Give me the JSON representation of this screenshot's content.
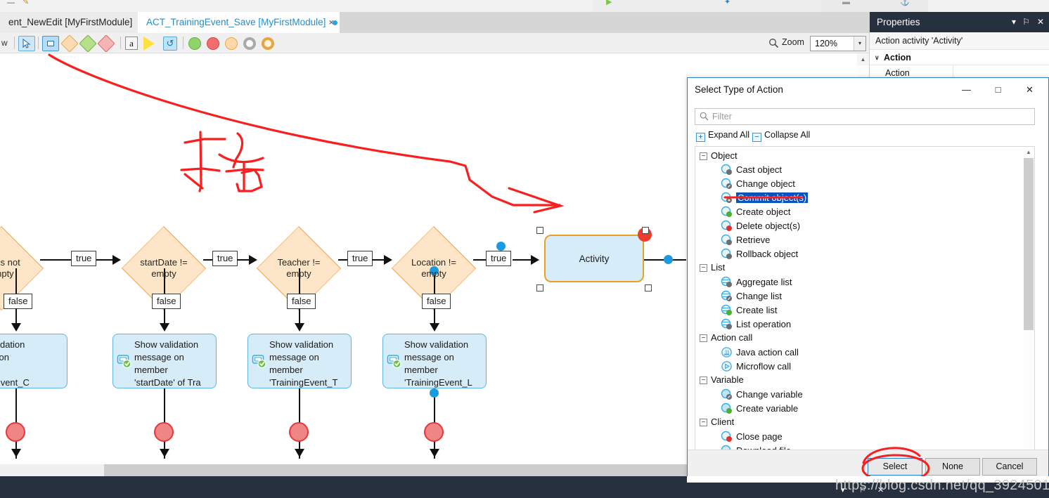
{
  "tabs": [
    {
      "label": "ent_NewEdit [MyFirstModule]",
      "active": false,
      "dirty": false
    },
    {
      "label": "ACT_TrainingEvent_Save [MyFirstModule]",
      "active": true,
      "dirty": true,
      "close": "×"
    }
  ],
  "toolbar": {
    "left_text": "w",
    "icons": [
      "select-arrow-icon",
      "object-activity-icon",
      "decision-orange-icon",
      "decision-green-icon",
      "decision-red-icon",
      "annotation-a-icon",
      "yellow-arrow-icon",
      "loop-icon",
      "green-circle-icon",
      "red-circle-icon",
      "peach-circle-icon",
      "grey-circle-icon",
      "orange-circle-icon"
    ],
    "zoom_label": "Zoom",
    "zoom_value": "120%",
    "zoom_caret": "▾"
  },
  "properties": {
    "title": "Properties",
    "caret": "▾",
    "pin": "⚐",
    "close": "✕",
    "subtitle": "Action activity 'Activity'",
    "group": "Action",
    "group_chevron": "∨",
    "rows": [
      {
        "label": "Action",
        "value": ""
      }
    ]
  },
  "diagram": {
    "decisions": [
      {
        "text": "urses not\nempty"
      },
      {
        "text": "startDate !=\nempty"
      },
      {
        "text": "Teacher !=\nempty"
      },
      {
        "text": "Location !=\nempty"
      }
    ],
    "true_labels": [
      "true",
      "true",
      "true",
      "true"
    ],
    "false_labels": [
      "false",
      "false",
      "false",
      "false"
    ],
    "activities": [
      {
        "text": "how validation\nessage on\nember\nrainingEvent_C"
      },
      {
        "text": "Show validation\nmessage on\nmember\n'startDate' of Tra"
      },
      {
        "text": "Show validation\nmessage on\nmember\n'TrainingEvent_T"
      },
      {
        "text": "Show validation\nmessage on\nmember\n'TrainingEvent_L"
      }
    ],
    "selected_activity": "Activity"
  },
  "dialog": {
    "title": "Select Type of Action",
    "minimize": "—",
    "maximize": "□",
    "close": "✕",
    "filter_placeholder": "Filter",
    "search_icon": "search-icon",
    "expand_all": "Expand All",
    "collapse_all": "Collapse All",
    "expand_sign": "+",
    "collapse_sign": "−",
    "tree": [
      {
        "group": "Object",
        "items": [
          {
            "label": "Cast object",
            "icon": "cast-object-icon",
            "selected": false
          },
          {
            "label": "Change object",
            "icon": "change-object-icon",
            "selected": false
          },
          {
            "label": "Commit object(s)",
            "icon": "commit-object-icon",
            "selected": true
          },
          {
            "label": "Create object",
            "icon": "create-object-icon",
            "selected": false
          },
          {
            "label": "Delete object(s)",
            "icon": "delete-object-icon",
            "selected": false
          },
          {
            "label": "Retrieve",
            "icon": "retrieve-icon",
            "selected": false
          },
          {
            "label": "Rollback object",
            "icon": "rollback-object-icon",
            "selected": false
          }
        ]
      },
      {
        "group": "List",
        "items": [
          {
            "label": "Aggregate list",
            "icon": "aggregate-list-icon",
            "selected": false
          },
          {
            "label": "Change list",
            "icon": "change-list-icon",
            "selected": false
          },
          {
            "label": "Create list",
            "icon": "create-list-icon",
            "selected": false
          },
          {
            "label": "List operation",
            "icon": "list-operation-icon",
            "selected": false
          }
        ]
      },
      {
        "group": "Action call",
        "items": [
          {
            "label": "Java action call",
            "icon": "java-action-icon",
            "selected": false
          },
          {
            "label": "Microflow call",
            "icon": "microflow-call-icon",
            "selected": false
          }
        ]
      },
      {
        "group": "Variable",
        "items": [
          {
            "label": "Change variable",
            "icon": "change-variable-icon",
            "selected": false
          },
          {
            "label": "Create variable",
            "icon": "create-variable-icon",
            "selected": false
          }
        ]
      },
      {
        "group": "Client",
        "items": [
          {
            "label": "Close page",
            "icon": "close-page-icon",
            "selected": false
          },
          {
            "label": "Download file",
            "icon": "download-file-icon",
            "selected": false
          }
        ]
      }
    ],
    "buttons": {
      "select": "Select",
      "none": "None",
      "cancel": "Cancel"
    }
  },
  "watermark": "https://blog.csdn.net/qq_39245017",
  "colors": {
    "accent_blue": "#1e8fd1",
    "selection_blue": "#0a53be",
    "marker_red": "#fa1f1f",
    "decision_fill": "#fde5c8",
    "decision_stroke": "#eeab5e",
    "activity_fill": "#d6ecf9",
    "activity_stroke": "#5fb4e0",
    "selected_stroke": "#eaa026",
    "panel_dark": "#26303f"
  }
}
